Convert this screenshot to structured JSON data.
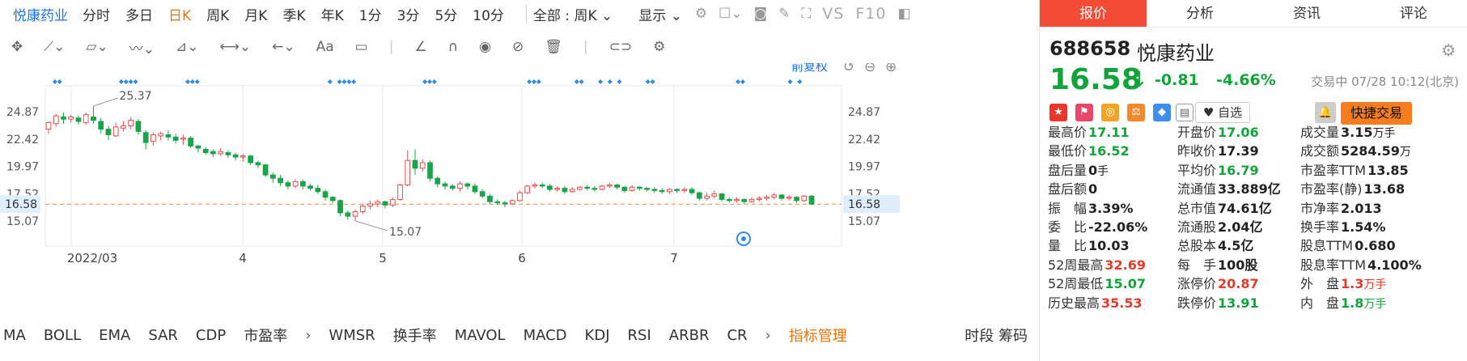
{
  "chart_header": {
    "stock_name": "悦康药业",
    "periods": [
      "分时",
      "多日",
      "日K",
      "周K",
      "月K",
      "季K",
      "年K",
      "1分",
      "3分",
      "5分",
      "10分"
    ],
    "active_period": "日K",
    "all_select": "全部 : 周K",
    "display_select": "显示",
    "vs_label": "VS",
    "f10_label": "F10"
  },
  "chart_controls": {
    "adjust_label": "前复权"
  },
  "chart_data": {
    "type": "candlestick",
    "y_ticks": [
      "24.87",
      "22.42",
      "19.97",
      "17.52",
      "15.07"
    ],
    "x_ticks": [
      "2022/03",
      "4",
      "5",
      "6",
      "7"
    ],
    "current_price_label": "16.58",
    "high_annotation": "25.37",
    "low_annotation": "15.07",
    "ylim": [
      13.5,
      26.5
    ],
    "candles": [
      [
        23.3,
        23.9,
        22.9,
        24.0
      ],
      [
        23.8,
        24.5,
        23.5,
        24.7
      ],
      [
        24.4,
        24.2,
        23.8,
        24.8
      ],
      [
        24.2,
        24.4,
        23.9,
        24.6
      ],
      [
        24.3,
        24.0,
        23.7,
        24.5
      ],
      [
        23.9,
        24.6,
        23.7,
        24.8
      ],
      [
        24.4,
        24.1,
        23.8,
        25.37
      ],
      [
        24.0,
        23.3,
        22.9,
        24.3
      ],
      [
        23.3,
        22.8,
        22.3,
        23.6
      ],
      [
        22.7,
        23.5,
        22.6,
        23.9
      ],
      [
        23.4,
        23.6,
        23.1,
        24.0
      ],
      [
        23.6,
        24.1,
        23.3,
        24.4
      ],
      [
        24.0,
        23.1,
        22.8,
        24.2
      ],
      [
        23.0,
        22.1,
        21.5,
        23.2
      ],
      [
        22.2,
        22.8,
        21.8,
        23.0
      ],
      [
        22.7,
        22.9,
        22.3,
        23.1
      ],
      [
        22.8,
        22.6,
        22.3,
        23.2
      ],
      [
        22.6,
        22.3,
        22.0,
        22.9
      ],
      [
        22.4,
        22.5,
        21.9,
        22.8
      ],
      [
        22.5,
        21.8,
        21.6,
        22.7
      ],
      [
        21.8,
        21.6,
        21.2,
        21.9
      ],
      [
        21.5,
        21.2,
        21.0,
        21.7
      ],
      [
        21.3,
        21.1,
        20.8,
        21.5
      ],
      [
        21.1,
        21.3,
        20.9,
        21.6
      ],
      [
        21.2,
        21.0,
        20.7,
        21.4
      ],
      [
        21.0,
        20.8,
        20.5,
        21.2
      ],
      [
        20.8,
        20.9,
        20.4,
        21.1
      ],
      [
        20.9,
        20.3,
        20.1,
        21.0
      ],
      [
        20.3,
        20.1,
        19.8,
        20.5
      ],
      [
        20.1,
        19.2,
        19.0,
        20.2
      ],
      [
        19.2,
        18.9,
        18.5,
        19.4
      ],
      [
        18.9,
        18.5,
        18.2,
        19.2
      ],
      [
        18.5,
        18.2,
        17.9,
        18.7
      ],
      [
        18.2,
        18.6,
        18.0,
        18.8
      ],
      [
        18.6,
        18.2,
        17.9,
        18.8
      ],
      [
        18.2,
        18.0,
        17.8,
        18.4
      ],
      [
        18.0,
        17.7,
        17.5,
        18.3
      ],
      [
        17.7,
        17.2,
        16.9,
        17.9
      ],
      [
        17.2,
        16.9,
        16.7,
        17.3
      ],
      [
        16.9,
        15.8,
        15.5,
        17.0
      ],
      [
        15.8,
        15.5,
        15.2,
        16.0
      ],
      [
        15.5,
        15.9,
        15.07,
        16.1
      ],
      [
        15.9,
        16.4,
        15.7,
        16.6
      ],
      [
        16.4,
        16.6,
        16.1,
        16.9
      ],
      [
        16.6,
        16.8,
        16.3,
        17.0
      ],
      [
        16.8,
        16.5,
        16.2,
        16.9
      ],
      [
        16.5,
        17.0,
        16.3,
        17.2
      ],
      [
        17.0,
        18.3,
        16.9,
        18.4
      ],
      [
        18.3,
        20.5,
        18.2,
        21.4
      ],
      [
        20.5,
        19.8,
        19.2,
        21.5
      ],
      [
        19.8,
        20.3,
        19.5,
        20.6
      ],
      [
        20.3,
        18.9,
        18.6,
        20.5
      ],
      [
        18.9,
        18.4,
        18.1,
        19.1
      ],
      [
        18.4,
        18.2,
        17.9,
        18.6
      ],
      [
        18.2,
        18.0,
        17.8,
        18.4
      ],
      [
        18.0,
        18.4,
        17.7,
        18.6
      ],
      [
        18.4,
        18.2,
        17.9,
        18.5
      ],
      [
        18.2,
        17.7,
        17.5,
        18.4
      ],
      [
        17.7,
        17.3,
        17.1,
        17.9
      ],
      [
        17.3,
        16.8,
        16.6,
        17.5
      ],
      [
        16.8,
        16.7,
        16.5,
        17.0
      ],
      [
        16.7,
        16.6,
        16.3,
        16.9
      ],
      [
        16.6,
        16.9,
        16.5,
        17.0
      ],
      [
        16.9,
        17.6,
        16.8,
        17.8
      ],
      [
        17.6,
        18.2,
        17.5,
        18.3
      ],
      [
        18.2,
        18.3,
        18.0,
        18.5
      ],
      [
        18.3,
        18.2,
        18.0,
        18.5
      ],
      [
        18.2,
        17.9,
        17.7,
        18.4
      ],
      [
        17.9,
        18.0,
        17.7,
        18.2
      ],
      [
        18.0,
        17.7,
        17.5,
        18.2
      ],
      [
        17.7,
        17.9,
        17.6,
        18.1
      ],
      [
        17.9,
        18.1,
        17.8,
        18.2
      ],
      [
        18.1,
        18.0,
        17.8,
        18.3
      ],
      [
        18.0,
        17.9,
        17.7,
        18.2
      ],
      [
        17.9,
        18.2,
        17.8,
        18.3
      ],
      [
        18.2,
        18.3,
        18.0,
        18.5
      ],
      [
        18.3,
        18.1,
        17.9,
        18.4
      ],
      [
        18.1,
        17.8,
        17.6,
        18.2
      ],
      [
        17.8,
        18.1,
        17.7,
        18.3
      ],
      [
        18.1,
        18.0,
        17.8,
        18.2
      ],
      [
        18.0,
        17.9,
        17.7,
        18.1
      ],
      [
        17.9,
        17.8,
        17.6,
        18.1
      ],
      [
        17.8,
        17.7,
        17.5,
        18.0
      ],
      [
        17.7,
        17.9,
        17.5,
        18.0
      ],
      [
        17.9,
        17.8,
        17.6,
        18.0
      ],
      [
        17.8,
        17.9,
        17.6,
        18.1
      ],
      [
        17.9,
        17.6,
        17.4,
        18.1
      ],
      [
        17.6,
        17.1,
        16.9,
        17.7
      ],
      [
        17.1,
        17.3,
        16.9,
        17.6
      ],
      [
        17.3,
        17.5,
        17.1,
        17.8
      ],
      [
        17.5,
        17.0,
        16.8,
        17.6
      ],
      [
        17.0,
        16.9,
        16.7,
        17.2
      ],
      [
        16.9,
        17.0,
        16.7,
        17.2
      ],
      [
        17.0,
        16.8,
        16.6,
        17.1
      ],
      [
        16.8,
        17.0,
        16.7,
        17.2
      ],
      [
        17.0,
        17.1,
        16.8,
        17.3
      ],
      [
        17.1,
        17.2,
        16.9,
        17.4
      ],
      [
        17.2,
        17.4,
        17.0,
        17.6
      ],
      [
        17.4,
        17.1,
        16.9,
        17.5
      ],
      [
        17.1,
        17.2,
        16.9,
        17.4
      ],
      [
        17.2,
        16.9,
        16.7,
        17.3
      ],
      [
        16.9,
        17.3,
        16.8,
        17.4
      ],
      [
        17.3,
        16.58,
        16.52,
        17.4
      ]
    ],
    "signal_dots": [
      1,
      2,
      15,
      16,
      17,
      18,
      29,
      30,
      31,
      59,
      61,
      62,
      63,
      64,
      79,
      80,
      81,
      101,
      102,
      103,
      111,
      112,
      116,
      118,
      120,
      126,
      127,
      145,
      146,
      156,
      158
    ]
  },
  "indicators": {
    "items": [
      "MA",
      "BOLL",
      "EMA",
      "SAR",
      "CDP",
      "市盈率"
    ],
    "items2": [
      "WMSR",
      "换手率",
      "MAVOL",
      "MACD",
      "KDJ",
      "RSI",
      "ARBR",
      "CR"
    ],
    "manage": "指标管理",
    "right1": "时段",
    "right2": "筹码"
  },
  "quote": {
    "tabs": [
      "报价",
      "分析",
      "资讯",
      "评论"
    ],
    "code": "688658",
    "name": "悦康药业",
    "price": "16.58",
    "change": "-0.81",
    "change_pct": "-4.66%",
    "trade_time": "交易中 07/28 10:12(北京)",
    "watch_label": "自选",
    "fast_trade_label": "快捷交易",
    "stats": [
      [
        {
          "l": "最高价",
          "v": "17.11",
          "c": "green"
        },
        {
          "l": "开盘价",
          "v": "17.06",
          "c": "green"
        },
        {
          "l": "成交量",
          "v": "3.15",
          "u": "万手",
          "c": "dark"
        }
      ],
      [
        {
          "l": "最低价",
          "v": "16.52",
          "c": "green"
        },
        {
          "l": "昨收价",
          "v": "17.39",
          "c": "dark"
        },
        {
          "l": "成交额",
          "v": "5284.59",
          "u": "万",
          "c": "dark"
        }
      ],
      [
        {
          "l": "盘后量",
          "v": "0",
          "u": "手",
          "c": "dark"
        },
        {
          "l": "平均价",
          "v": "16.79",
          "c": "green"
        },
        {
          "l": "市盈率TTM",
          "v": "13.85",
          "c": "dark"
        }
      ],
      [
        {
          "l": "盘后额",
          "v": "0",
          "c": "dark"
        },
        {
          "l": "流通值",
          "v": "33.889亿",
          "c": "dark"
        },
        {
          "l": "市盈率(静)",
          "v": "13.68",
          "c": "dark"
        }
      ],
      [
        {
          "l": "振　幅",
          "v": "3.39%",
          "c": "dark"
        },
        {
          "l": "总市值",
          "v": "74.61亿",
          "c": "dark"
        },
        {
          "l": "市净率",
          "v": "2.013",
          "c": "dark"
        }
      ],
      [
        {
          "l": "委　比",
          "v": "-22.06%",
          "c": "dark"
        },
        {
          "l": "流通股",
          "v": "2.04亿",
          "c": "dark"
        },
        {
          "l": "换手率",
          "v": "1.54%",
          "c": "dark"
        }
      ],
      [
        {
          "l": "量　比",
          "v": "10.03",
          "c": "dark"
        },
        {
          "l": "总股本",
          "v": "4.5亿",
          "c": "dark"
        },
        {
          "l": "股息TTM",
          "v": "0.680",
          "c": "dark"
        }
      ],
      [
        {
          "l": "52周最高",
          "v": "32.69",
          "c": "red"
        },
        {
          "l": "每　手",
          "v": "100股",
          "c": "dark"
        },
        {
          "l": "股息率TTM",
          "v": "4.100%",
          "c": "dark"
        }
      ],
      [
        {
          "l": "52周最低",
          "v": "15.07",
          "c": "green"
        },
        {
          "l": "涨停价",
          "v": "20.87",
          "c": "red"
        },
        {
          "l": "外　盘",
          "v": "1.3",
          "u": "万手",
          "c": "red"
        }
      ],
      [
        {
          "l": "历史最高",
          "v": "35.53",
          "c": "red"
        },
        {
          "l": "跌停价",
          "v": "13.91",
          "c": "green"
        },
        {
          "l": "内　盘",
          "v": "1.8",
          "u": "万手",
          "c": "green"
        }
      ]
    ]
  }
}
